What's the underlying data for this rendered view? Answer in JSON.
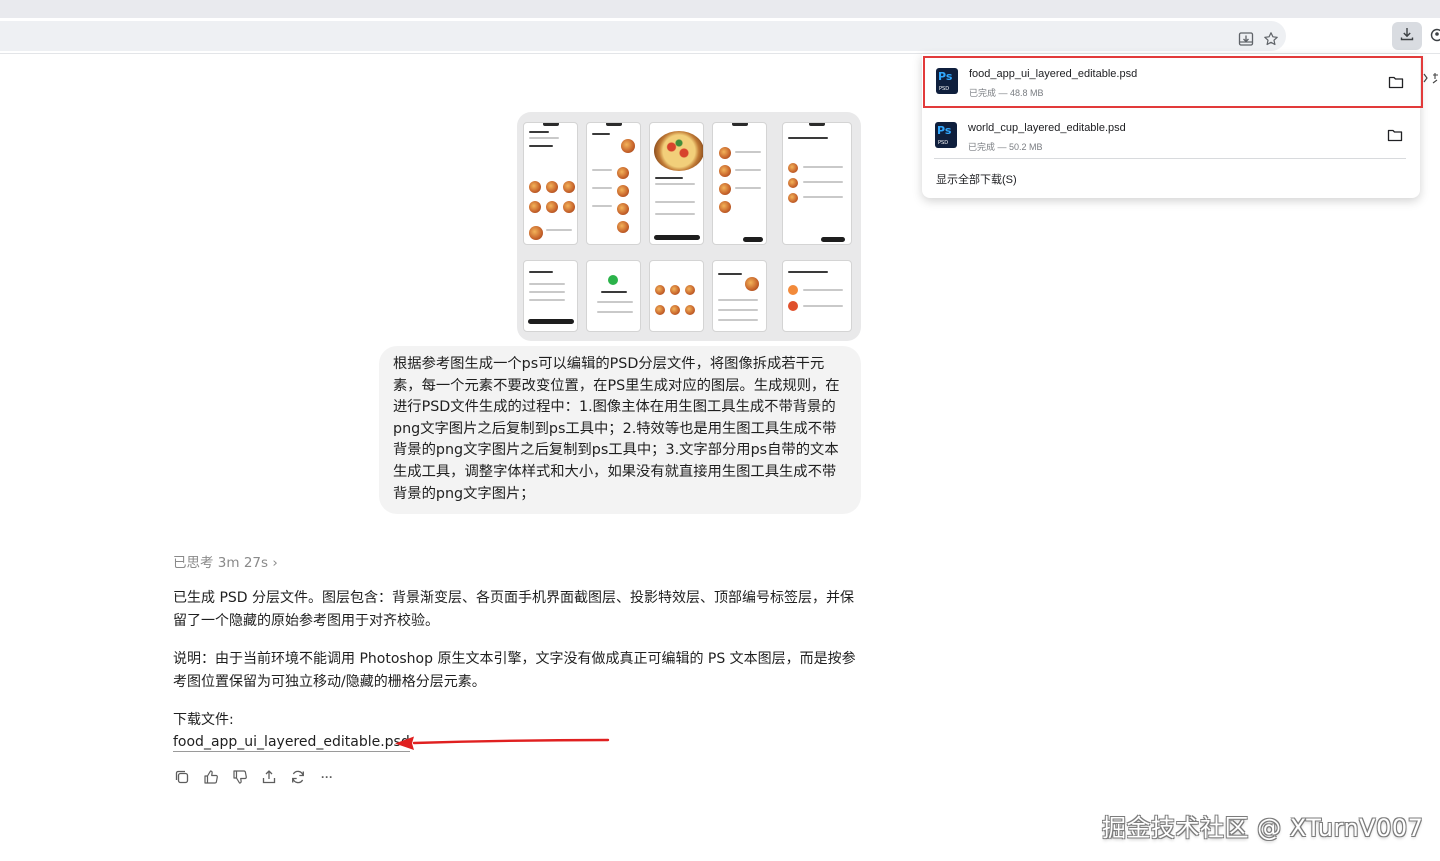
{
  "downloads": {
    "items": [
      {
        "name": "food_app_ui_layered_editable.psd",
        "status": "已完成 — 48.8 MB",
        "icon": "photoshop-file-icon",
        "selected": true
      },
      {
        "name": "world_cup_layered_editable.psd",
        "status": "已完成 — 50.2 MB",
        "icon": "photoshop-file-icon",
        "selected": false
      }
    ],
    "show_all": "显示全部下载(S)"
  },
  "user_message": {
    "text": "根据参考图生成一个ps可以编辑的PSD分层文件，将图像拆成若干元素，每一个元素不要改变位置，在PS里生成对应的图层。生成规则，在进行PSD文件生成的过程中：1.图像主体在用生图工具生成不带背景的png文字图片之后复制到ps工具中；2.特效等也是用生图工具生成不带背景的png文字图片之后复制到ps工具中；3.文字部分用ps自带的文本生成工具，调整字体样式和大小，如果没有就直接用生图工具生成不带背景的png文字图片；"
  },
  "assistant": {
    "thought_label": "已思考 3m 27s",
    "thought_chevron": "›",
    "paragraph1": "已生成 PSD 分层文件。图层包含：背景渐变层、各页面手机界面截图层、投影特效层、顶部编号标签层，并保留了一个隐藏的原始参考图用于对齐校验。",
    "paragraph2": "说明：由于当前环境不能调用 Photoshop 原生文本引擎，文字没有做成真正可编辑的 PS 文本图层，而是按参考图位置保留为可独立移动/隐藏的栅格分层元素。",
    "download_label": "下载文件:",
    "download_link": "food_app_ui_layered_editable.psd",
    "actions": [
      "copy-icon",
      "thumbs-up-icon",
      "thumbs-down-icon",
      "share-icon",
      "regenerate-icon",
      "more-icon"
    ],
    "more_glyph": "···"
  },
  "watermark": "掘金技术社区 @ XTurnV007",
  "colors": {
    "highlight": "#e23a3a",
    "arrow": "#e02020",
    "ps_blue": "#31a8ff",
    "ps_bg": "#0f1f3d"
  }
}
